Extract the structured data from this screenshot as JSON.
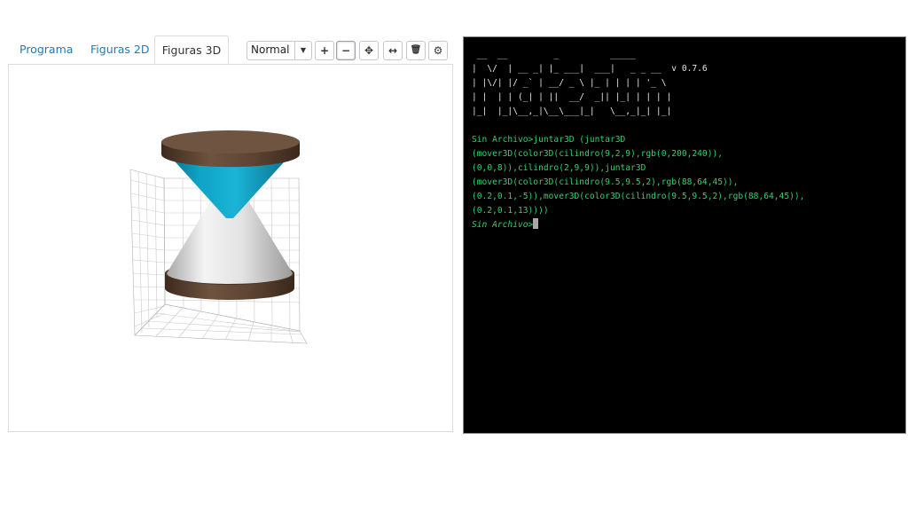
{
  "tabs": [
    {
      "label": "Programa",
      "active": false
    },
    {
      "label": "Figuras 2D",
      "active": false
    },
    {
      "label": "Figuras 3D",
      "active": true
    }
  ],
  "toolbar": {
    "view_mode": "Normal",
    "buttons": [
      {
        "icon": "plus-icon",
        "glyph": "+"
      },
      {
        "icon": "minus-icon",
        "glyph": "−"
      },
      {
        "icon": "move-icon",
        "glyph": "✥"
      },
      {
        "icon": "horizontal-arrows-icon",
        "glyph": "↔"
      },
      {
        "icon": "trash-icon",
        "glyph": "🗑"
      },
      {
        "icon": "gear-icon",
        "glyph": "⚙"
      }
    ]
  },
  "scene": {
    "figures": [
      {
        "shape": "cilindro",
        "args": [
          9,
          2,
          9
        ],
        "color": "#00c8f0",
        "displayed_as": "upper cone"
      },
      {
        "shape": "cilindro",
        "args": [
          2,
          9,
          9
        ],
        "color": "#e6e6e6",
        "displayed_as": "lower cone"
      },
      {
        "shape": "cilindro",
        "args": [
          9.5,
          9.5,
          2
        ],
        "color": "#58402d",
        "displayed_as": "bottom disc"
      },
      {
        "shape": "cilindro",
        "args": [
          9.5,
          9.5,
          2
        ],
        "color": "#58402d",
        "displayed_as": "top disc"
      }
    ]
  },
  "terminal": {
    "banner": [
      " __  __         _          _____",
      "|  \\/  | __ _| |_ ___|  ___|   _ _ __  v 0.7.6",
      "| |\\/| |/ _` | __/ _ \\ |_ | | | | '_ \\",
      "| |  | | (_| | ||  __/  _|| |_| | | | |",
      "|_|  |_|\\__,_|\\__\\___|_|   \\__,_|_| |_|"
    ],
    "command_lines": [
      "Sin Archivo>juntar3D (juntar3D",
      "(mover3D(color3D(cilindro(9,2,9),rgb(0,200,240)),",
      "(0,0,8)),cilindro(2,9,9)),juntar3D",
      "(mover3D(color3D(cilindro(9.5,9.5,2),rgb(88,64,45)),",
      "(0.2,0.1,-5)),mover3D(color3D(cilindro(9.5,9.5,2),rgb(88,64,45)),",
      "(0.2,0.1,13))))"
    ],
    "prompt": "Sin Archivo>"
  }
}
